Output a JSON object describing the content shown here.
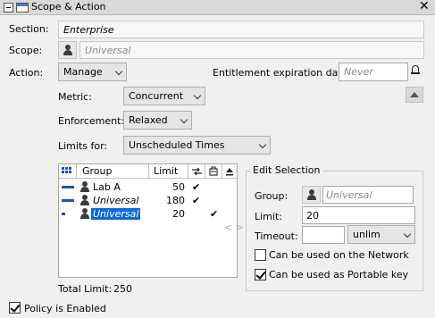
{
  "window": {
    "title": "Scope & Action",
    "close_glyph": "✕"
  },
  "section": {
    "label": "Section:",
    "value": "Enterprise"
  },
  "scope": {
    "label": "Scope:",
    "placeholder": "Universal"
  },
  "action": {
    "label": "Action:",
    "value": "Manage"
  },
  "entitlement": {
    "label": "Entitlement expiration date:",
    "placeholder": "Never"
  },
  "metric": {
    "label": "Metric:",
    "value": "Concurrent"
  },
  "enforcement": {
    "label": "Enforcement:",
    "value": "Relaxed"
  },
  "limits_for": {
    "label": "Limits for:",
    "value": "Unscheduled Times"
  },
  "table": {
    "headers": {
      "group": "Group",
      "limit": "Limit"
    },
    "rows": [
      {
        "group": "Lab A",
        "limit": "50",
        "check1": "✔",
        "check2": "",
        "bar_fraction": 1.0
      },
      {
        "group": "Universal",
        "limit": "180",
        "check1": "✔",
        "check2": "",
        "bar_fraction": 1.0
      },
      {
        "group": "Universal",
        "limit": "20",
        "check1": "",
        "check2": "✔",
        "bar_fraction": 0.3
      }
    ],
    "total_label": "Total Limit:",
    "total_value": "250"
  },
  "edit_selection": {
    "title": "Edit Selection",
    "group_label": "Group:",
    "group_placeholder": "Universal",
    "limit_label": "Limit:",
    "limit_value": "20",
    "timeout_label": "Timeout:",
    "timeout_value": "",
    "timeout_unit": "unlim",
    "network_label": "Can be used on the Network",
    "network_checked": false,
    "portable_label": "Can be used as Portable key",
    "portable_checked": true
  },
  "move_arrows": "< >",
  "policy": {
    "label": "Policy is Enabled",
    "checked": true
  },
  "colors": {
    "accent": "#1f4fb8",
    "selection": "#0a6ad6"
  }
}
